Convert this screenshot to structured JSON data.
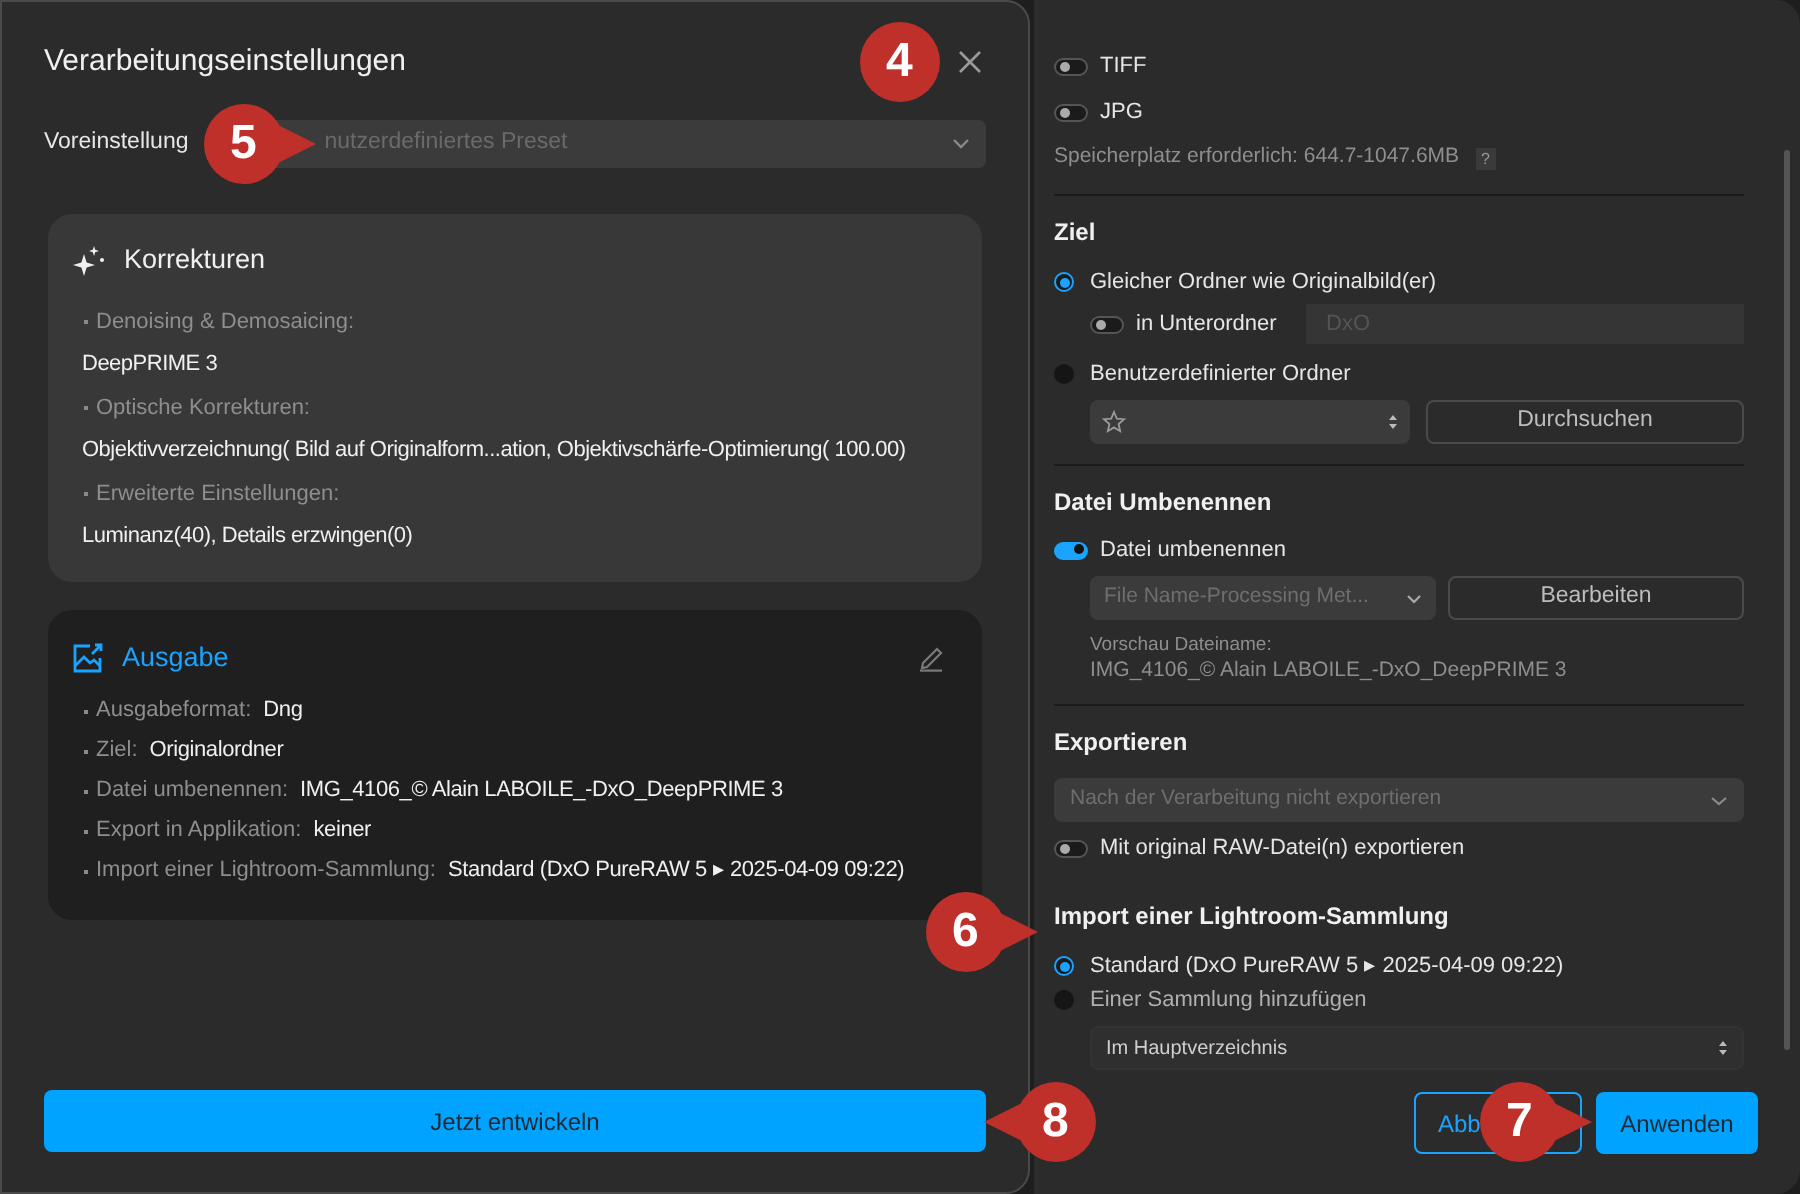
{
  "dialog": {
    "title": "Verarbeitungseinstellungen",
    "preset": {
      "label": "Voreinstellung",
      "value": "nutzerdefiniertes Preset"
    },
    "corrections": {
      "title": "Korrekturen",
      "items": [
        {
          "label": "Denoising & Demosaicing:",
          "value": "DeepPRIME 3"
        },
        {
          "label": "Optische Korrekturen:",
          "value": "Objektivverzeichnung( Bild auf Originalform...ation, Objektivschärfe-Optimierung( 100.00)"
        },
        {
          "label": "Erweiterte Einstellungen:",
          "value": "Luminanz(40), Details erzwingen(0)"
        }
      ]
    },
    "output": {
      "title": "Ausgabe",
      "items": [
        {
          "label": "Ausgabeformat:",
          "value": "Dng"
        },
        {
          "label": "Ziel:",
          "value": "Originalordner"
        },
        {
          "label": "Datei umbenennen:",
          "value": "IMG_4106_© Alain LABOILE_-DxO_DeepPRIME 3"
        },
        {
          "label": "Export in Applikation:",
          "value": "keiner"
        },
        {
          "label": "Import einer Lightroom-Sammlung:",
          "value": "Standard (DxO PureRAW 5 ▸ 2025-04-09 09:22)"
        }
      ]
    },
    "develop_button": "Jetzt entwickeln"
  },
  "panel": {
    "formats": [
      {
        "label": "TIFF",
        "on": false
      },
      {
        "label": "JPG",
        "on": false
      }
    ],
    "storage": "Speicherplatz erforderlich: 644.7-1047.6MB",
    "storage_help": "?",
    "destination": {
      "title": "Ziel",
      "options": [
        {
          "label": "Gleicher Ordner wie Originalbild(er)",
          "selected": true
        },
        {
          "label": "Benutzerdefinierter Ordner",
          "selected": false
        }
      ],
      "subfolder": {
        "label": "in Unterordner",
        "on": false,
        "placeholder": "DxO"
      },
      "browse_button": "Durchsuchen"
    },
    "rename": {
      "title": "Datei Umbenennen",
      "toggle": {
        "label": "Datei umbenennen",
        "on": true
      },
      "template": "File Name-Processing Met...",
      "edit_button": "Bearbeiten",
      "preview_label": "Vorschau Dateiname:",
      "preview": "IMG_4106_© Alain LABOILE_-DxO_DeepPRIME 3"
    },
    "export": {
      "title": "Exportieren",
      "select": "Nach der Verarbeitung nicht exportieren",
      "toggle": {
        "label": "Mit original RAW-Datei(n) exportieren",
        "on": false
      }
    },
    "lightroom": {
      "title": "Import einer Lightroom-Sammlung",
      "options": [
        {
          "label": "Standard (DxO PureRAW 5 ▸ 2025-04-09 09:22)",
          "selected": true
        },
        {
          "label": "Einer Sammlung hinzufügen",
          "selected": false
        }
      ],
      "select": "Im Hauptverzeichnis"
    },
    "cancel_button": "Abb",
    "apply_button": "Anwenden"
  },
  "callouts": [
    "4",
    "5",
    "6",
    "7",
    "8"
  ]
}
